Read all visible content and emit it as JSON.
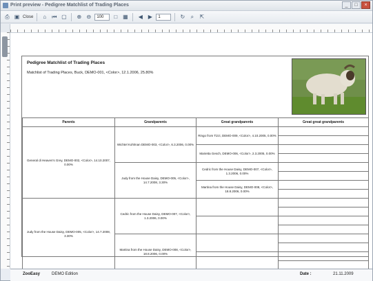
{
  "window": {
    "title": "Print preview - Pedigree Matchlist of Trading Places",
    "buttons": [
      "_",
      "□",
      "×"
    ]
  },
  "toolbar": {
    "close_label": "Close",
    "zoom_value": "100",
    "page_value": "1"
  },
  "document": {
    "title": "Pedigree Matchlist of Trading Places",
    "subtitle": "Matchlist of Trading Places, Buck, DEMO-001, <Color>, 12.1.2006, 25.80%",
    "headers": [
      "Parents",
      "Grandparents",
      "Great grandparents",
      "Great great grandparents"
    ],
    "parents": [
      "General di Heaven's Grey, DEMO-002, <Color>, 14.10.2007, 0.00%",
      "Judy from the House Daisy, DEMO-005, <Color>, 14.7.2008, 3.30%"
    ],
    "grandparents": [
      "Wichtel Kohlman DEMO-003, <Color>, 6.3.2006, 0.00%",
      "Judy from the House Daisy, DEMO-005, <Color>, 14.7.2008, 3.30%",
      "Cedric from the House Daisy, DEMO-007, <Color>, 1.3.2006, 0.00%",
      "Martina from the House Daisy, DEMO-008, <Color>, 18.8.2006, 0.00%"
    ],
    "great_grandparents": [
      "Ringo from Tizzi, DEMO-009, <Color>, 4.10.2005, 0.00%",
      "Marietta Gesch, DEMO-006, <Color>, 2.3.2005, 0.00%",
      "Cedric from the House Daisy, DEMO-007, <Color>, 1.3.2006, 0.00%",
      "Martina from the House Daisy, DEMO-008, <Color>, 18.8.2006, 0.00%"
    ]
  },
  "statusbar": {
    "app_label": "ZooEasy",
    "edition": "DEMO Edition",
    "date_label": "Date :",
    "date_value": "21.11.2009"
  },
  "colors": {
    "grass": "#5f8b2e",
    "goat": "#e3ddcf"
  }
}
